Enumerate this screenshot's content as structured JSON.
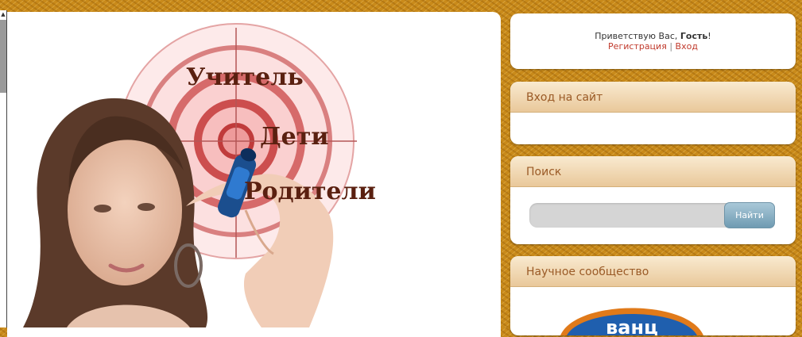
{
  "hero": {
    "word_teacher": "Учитель",
    "word_children": "Дети",
    "word_parents": "Родители"
  },
  "greeting": {
    "prefix": "Приветствую Вас,",
    "user": "Гость",
    "suffix": "!",
    "register_link": "Регистрация",
    "separator": "|",
    "login_link": "Вход"
  },
  "login_box": {
    "title": "Вход на сайт"
  },
  "search_box": {
    "title": "Поиск",
    "input_value": "",
    "button_label": "Найти"
  },
  "community_box": {
    "title": "Научное сообщество",
    "logo_text": "ванц"
  },
  "colors": {
    "background": "#c98a1a",
    "box_title": "#9a5a26",
    "link": "#c0392b",
    "logo_blue": "#1f5fae",
    "logo_orange": "#e07a1a"
  },
  "icons": {
    "scroll_up": "up-arrow-icon"
  }
}
